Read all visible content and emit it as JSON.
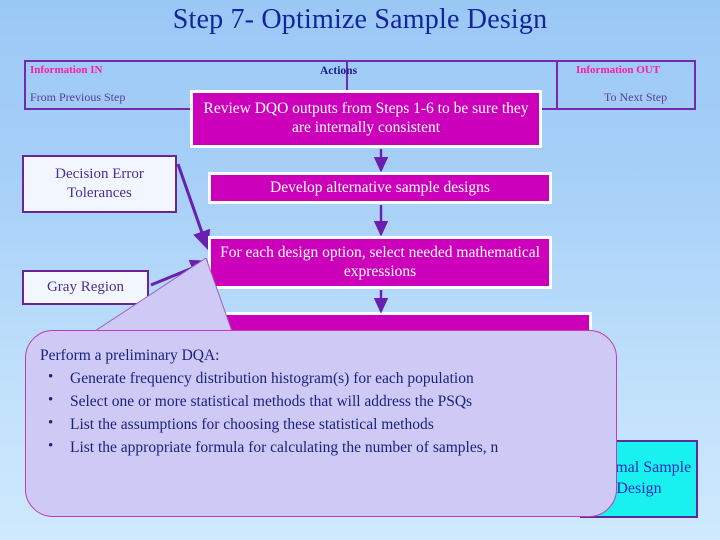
{
  "slide": {
    "title": "Step 7- Optimize Sample Design",
    "background_top": "#9ac8f5",
    "background_bottom": "#cfe9fd",
    "title_color": "#15239c"
  },
  "header": {
    "information_in": "Information IN",
    "actions": "Actions",
    "information_out": "Information OUT",
    "from_previous_step": "From Previous Step",
    "to_next_step": "To Next Step",
    "label_color": "#ff1aa8",
    "sub_color": "#5a3a9e",
    "border_color": "#7528b0"
  },
  "inputs": [
    {
      "label": "Decision Error Tolerances"
    },
    {
      "label": "Gray Region"
    }
  ],
  "actions": [
    {
      "label": "Review DQO outputs from Steps 1-6 to be sure they are internally consistent"
    },
    {
      "label": "Develop alternative sample designs"
    },
    {
      "label": "For each design option, select needed mathematical expressions"
    },
    {
      "label": ""
    }
  ],
  "action_style": {
    "fill": "#cc00bb",
    "border": "#ffffff",
    "text": "#ffffff"
  },
  "outputs": [
    {
      "label": "Optimal Sample Design",
      "fill": "#19f0f0",
      "text": "#2b2bb5"
    }
  ],
  "callout": {
    "heading": "Perform a preliminary DQA:",
    "bullets": [
      "Generate frequency distribution histogram(s) for each population",
      "Select one or more statistical methods that will address the PSQs",
      "List the assumptions for choosing these statistical methods",
      "List the appropriate formula for calculating the number of samples, n"
    ],
    "fill": "#cfc9f5",
    "border": "#c23ab5",
    "text_color": "#18237e"
  },
  "arrow_color": "#6a1fb0"
}
